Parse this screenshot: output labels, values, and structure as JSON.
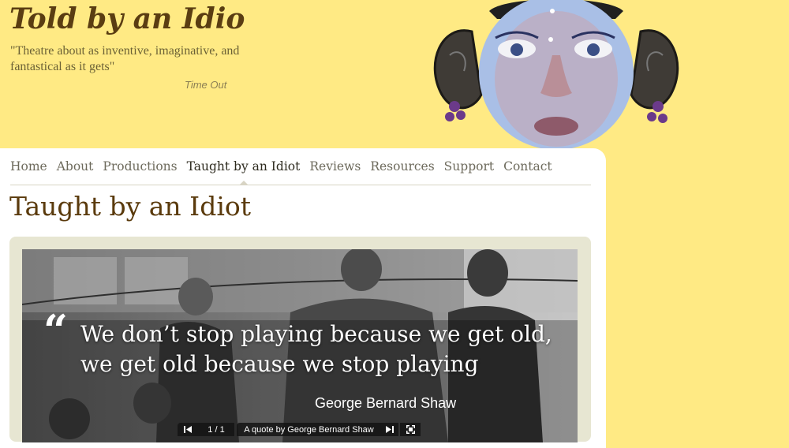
{
  "header": {
    "logo_text": "Told by an Idiot",
    "tagline": "\"Theatre about as inventive, imaginative, and fantastical as it gets\"",
    "tagline_source": "Time Out"
  },
  "nav": {
    "items": [
      {
        "label": "Home"
      },
      {
        "label": "About"
      },
      {
        "label": "Productions"
      },
      {
        "label": "Taught by an Idiot",
        "active": true
      },
      {
        "label": "Reviews"
      },
      {
        "label": "Resources"
      },
      {
        "label": "Support"
      },
      {
        "label": "Contact"
      }
    ]
  },
  "page": {
    "title": "Taught by an Idiot"
  },
  "slideshow": {
    "quote_mark": "“",
    "quote": "We don’t stop playing because we get old, we get old because we stop playing",
    "author": "George Bernard Shaw",
    "counter": "1 / 1",
    "caption": "A quote by George Bernard Shaw",
    "icons": {
      "prev": "skip-back-icon",
      "next": "skip-forward-icon",
      "fullscreen": "fullscreen-icon"
    }
  },
  "colors": {
    "background": "#ffea84",
    "panel": "#ffffff",
    "title": "#5a3a0c",
    "nav_text": "#6d6a5c",
    "slideshow_frame": "#e7e6d2"
  }
}
